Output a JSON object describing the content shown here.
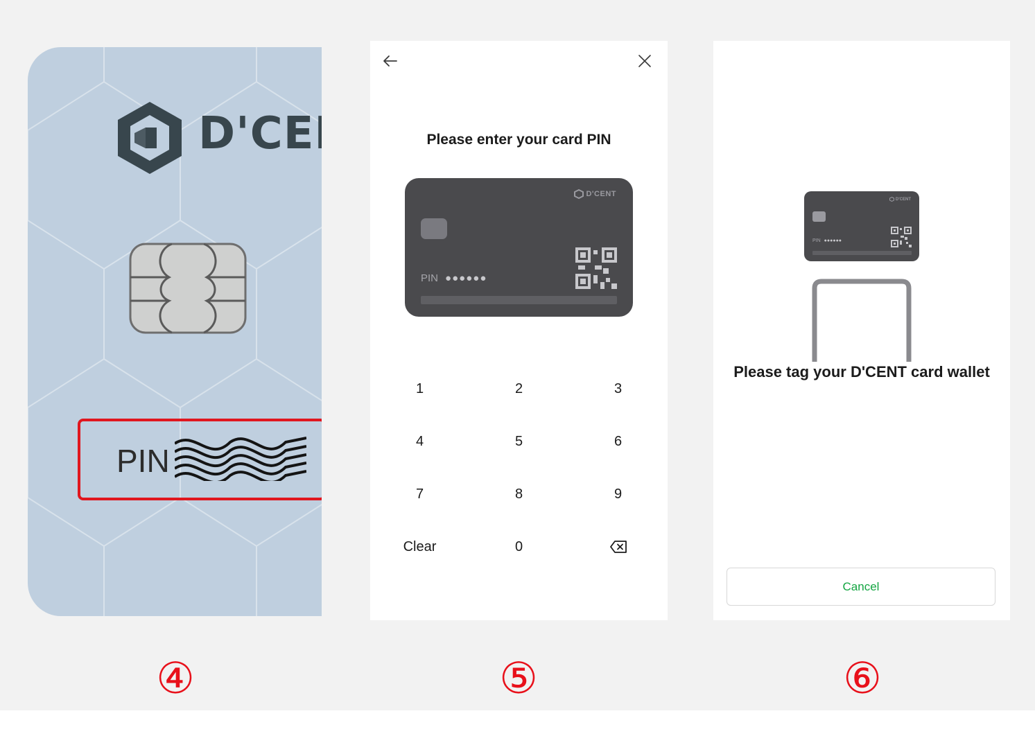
{
  "panel4": {
    "brand": "D'CEI",
    "pin_label": "PIN"
  },
  "screen5": {
    "title": "Please enter your card PIN",
    "card": {
      "brand": "D'CENT",
      "pin_label": "PIN",
      "pin_dots": "●●●●●●"
    },
    "keypad": [
      "1",
      "2",
      "3",
      "4",
      "5",
      "6",
      "7",
      "8",
      "9",
      "Clear",
      "0"
    ]
  },
  "screen6": {
    "card": {
      "brand": "D'CENT",
      "pin_label": "PIN",
      "pin_dots": "●●●●●●"
    },
    "title": "Please tag your D'CENT card wallet",
    "cancel_label": "Cancel"
  },
  "steps": [
    "④",
    "⑤",
    "⑥"
  ],
  "colors": {
    "accent_red": "#e8101a",
    "cancel_green": "#13a541",
    "card_dark": "#4a4a4d"
  }
}
